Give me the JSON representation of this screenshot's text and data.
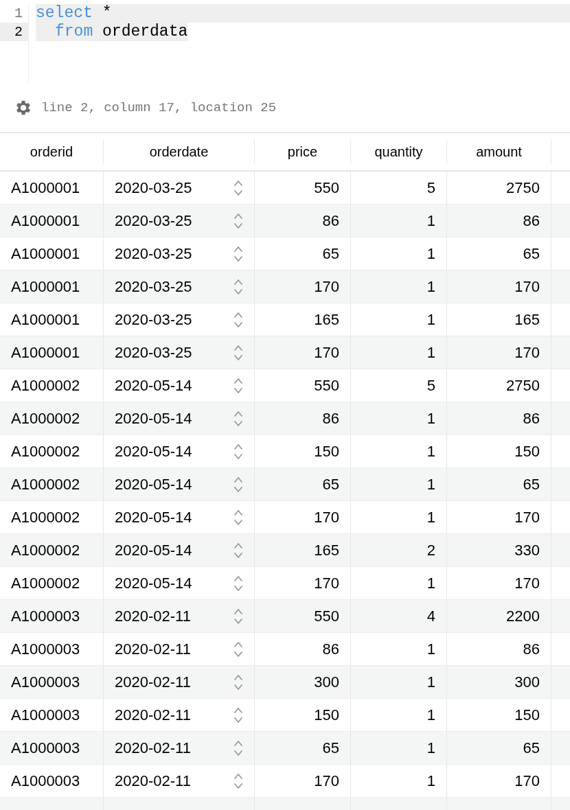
{
  "editor": {
    "lines": [
      {
        "number": "1",
        "current": false,
        "selected": true,
        "tokens": [
          {
            "kind": "keyword",
            "text": "select"
          },
          {
            "kind": "plain",
            "text": " *"
          }
        ]
      },
      {
        "number": "2",
        "current": true,
        "selected": true,
        "indented": true,
        "tokens": [
          {
            "kind": "keyword",
            "text": "from"
          },
          {
            "kind": "plain",
            "text": " orderdata"
          }
        ]
      }
    ]
  },
  "status_bar": {
    "text": "line 2, column 17, location 25"
  },
  "table": {
    "columns": [
      {
        "label": "orderid",
        "kind": "text"
      },
      {
        "label": "orderdate",
        "kind": "date"
      },
      {
        "label": "price",
        "kind": "number"
      },
      {
        "label": "quantity",
        "kind": "number"
      },
      {
        "label": "amount",
        "kind": "number"
      }
    ],
    "rows": [
      [
        "A1000001",
        "2020-03-25",
        "550",
        "5",
        "2750"
      ],
      [
        "A1000001",
        "2020-03-25",
        "86",
        "1",
        "86"
      ],
      [
        "A1000001",
        "2020-03-25",
        "65",
        "1",
        "65"
      ],
      [
        "A1000001",
        "2020-03-25",
        "170",
        "1",
        "170"
      ],
      [
        "A1000001",
        "2020-03-25",
        "165",
        "1",
        "165"
      ],
      [
        "A1000001",
        "2020-03-25",
        "170",
        "1",
        "170"
      ],
      [
        "A1000002",
        "2020-05-14",
        "550",
        "5",
        "2750"
      ],
      [
        "A1000002",
        "2020-05-14",
        "86",
        "1",
        "86"
      ],
      [
        "A1000002",
        "2020-05-14",
        "150",
        "1",
        "150"
      ],
      [
        "A1000002",
        "2020-05-14",
        "65",
        "1",
        "65"
      ],
      [
        "A1000002",
        "2020-05-14",
        "170",
        "1",
        "170"
      ],
      [
        "A1000002",
        "2020-05-14",
        "165",
        "2",
        "330"
      ],
      [
        "A1000002",
        "2020-05-14",
        "170",
        "1",
        "170"
      ],
      [
        "A1000003",
        "2020-02-11",
        "550",
        "4",
        "2200"
      ],
      [
        "A1000003",
        "2020-02-11",
        "86",
        "1",
        "86"
      ],
      [
        "A1000003",
        "2020-02-11",
        "300",
        "1",
        "300"
      ],
      [
        "A1000003",
        "2020-02-11",
        "150",
        "1",
        "150"
      ],
      [
        "A1000003",
        "2020-02-11",
        "65",
        "1",
        "65"
      ],
      [
        "A1000003",
        "2020-02-11",
        "170",
        "1",
        "170"
      ]
    ]
  }
}
